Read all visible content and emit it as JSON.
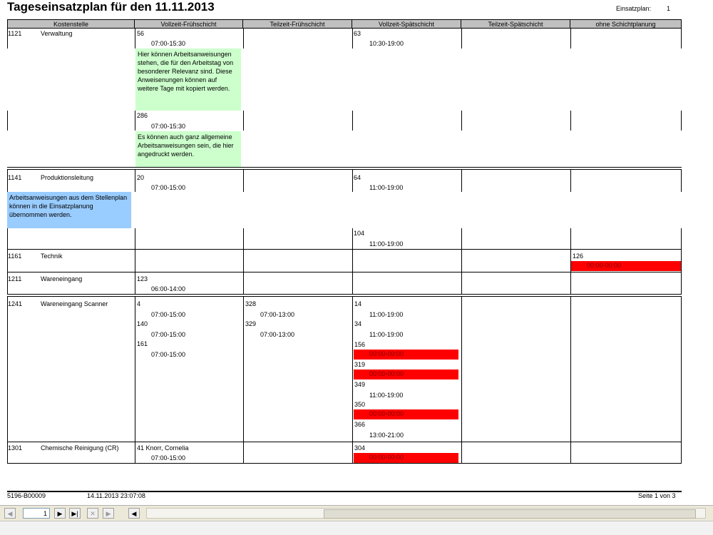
{
  "report": {
    "title": "Tageseinsatzplan für den 11.11.2013",
    "plan_label": "Einsatzplan:",
    "plan_value": "1"
  },
  "columns": [
    "Kostenstelle",
    "Vollzeit-Frühschicht",
    "Teilzeit-Frühschicht",
    "Vollzeit-Spätschicht",
    "Teilzeit-Spätschicht",
    "ohne Schichtplanung"
  ],
  "rows": {
    "r1121": {
      "code": "1121",
      "name": "Verwaltung",
      "vf1_id": "56",
      "vf1_time": "07:00-15:30",
      "note1": "Hier können Arbeitsanweisungen stehen, die für den Arbeitstag von besonderer Relevanz sind. Diese Anweisenungen können auf weitere Tage mit kopiert werden.",
      "vf2_id": "286",
      "vf2_time": "07:00-15:30",
      "note2": "Es können auch ganz allgemeine Arbeitsanweisungen sein, die hier angedruckt werden.",
      "vs1_id": "63",
      "vs1_time": "10:30-19:00"
    },
    "r1141": {
      "code": "1141",
      "name": "Produktionsleitung",
      "vf1_id": "20",
      "vf1_time": "07:00-15:00",
      "vs1_id": "64",
      "vs1_time": "11:00-19:00",
      "note": "Arbeitsanweisungen aus dem Stellenplan können in die Einsatzplanung übernommen werden.",
      "vs2_id": "104",
      "vs2_time": "11:00-19:00"
    },
    "r1161": {
      "code": "1161",
      "name": "Technik",
      "os_id": "126",
      "os_time": "00:00-00:00"
    },
    "r1211": {
      "code": "1211",
      "name": "Wareneingang",
      "vf1_id": "123",
      "vf1_time": "06:00-14:00"
    },
    "r1241": {
      "code": "1241",
      "name": "Wareneingang Scanner",
      "vf": [
        {
          "id": "4",
          "time": "07:00-15:00"
        },
        {
          "id": "140",
          "time": "07:00-15:00"
        },
        {
          "id": "161",
          "time": "07:00-15:00"
        }
      ],
      "tf": [
        {
          "id": "328",
          "time": "07:00-13:00"
        },
        {
          "id": "329",
          "time": "07:00-13:00"
        }
      ],
      "vs": [
        {
          "id": "14",
          "time": "11:00-19:00"
        },
        {
          "id": "34",
          "time": "11:00-19:00"
        },
        {
          "id": "156",
          "time": "00:00-00:00"
        },
        {
          "id": "319",
          "time": "00:00-00:00"
        },
        {
          "id": "349",
          "time": "11:00-19:00"
        },
        {
          "id": "350",
          "time": "00:00-00:00"
        },
        {
          "id": "366",
          "time": "13:00-21:00"
        }
      ]
    },
    "r1301": {
      "code": "1301",
      "name": "Chemische Reinigung (CR)",
      "vf1_id": "41 Knorr, Cornelia",
      "vf1_time": "07:00-15:00",
      "vs1_id": "304",
      "vs1_time": "00:00-00:00"
    }
  },
  "footer": {
    "id": "5196-B00009",
    "timestamp": "14.11.2013 23:07:08",
    "page": "Seite 1 von 3"
  },
  "toolbar": {
    "page_number": "1"
  },
  "colors": {
    "header_bg": "#c0c0c0",
    "note_green": "#ccffcc",
    "note_blue": "#99ccff",
    "alert_red": "#ff0000"
  }
}
